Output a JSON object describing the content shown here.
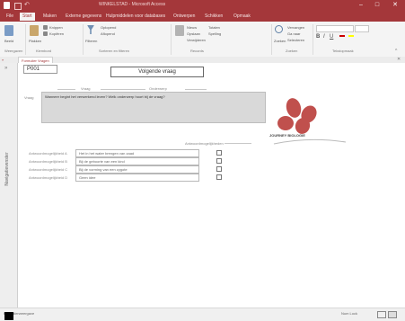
{
  "titlebar": {
    "title": "WINKELSTAD - Microsoft Access",
    "minimize": "–",
    "maximize": "□",
    "close": "✕"
  },
  "tabs": [
    "File",
    "Start",
    "Maken",
    "Externe gegevens",
    "Hulpmiddelen voor databases",
    "Ontwerpen",
    "Schikken",
    "Opmaak"
  ],
  "ribbon": {
    "groups": [
      "Weergaven",
      "Klembord",
      "Sorteren en filteren",
      "Records",
      "Zoeken",
      "Tekstopmaak"
    ],
    "buttons": [
      "Beeld",
      "Plakken",
      "Knippen",
      "Kopiëren",
      "Filteren",
      "Oplopend",
      "Aflopend",
      "Nieuw",
      "Opslaan",
      "Verwijderen",
      "Totalen",
      "Spelling",
      "Zoeken",
      "Vervangen",
      "Ga naar",
      "Selecteren"
    ]
  },
  "objtab": {
    "label": "Formulier Vragen"
  },
  "nav": {
    "label": "Navigatievenster"
  },
  "form": {
    "id_value": "P001",
    "title_button": "Volgende vraag",
    "col_left": "Vraag",
    "col_right": "Onderwerp",
    "q_label": "Vraag",
    "question": "Wanneer begint het verwerkend leven? Welk onderwerp hoort bij de vraag?",
    "answer_header": "Antwoordmogelijkheden",
    "answers": [
      {
        "label": "Antwoordmogelijkheid A",
        "value": "Het in het water brengen van zaad"
      },
      {
        "label": "Antwoordmogelijkheid B",
        "value": "Bij de geboorte van een kind"
      },
      {
        "label": "Antwoordmogelijkheid C",
        "value": "Bij de vorming van een zygote"
      },
      {
        "label": "Antwoordmogelijkheid D",
        "value": "Geen idee"
      }
    ],
    "logo_text": "JOURNEY BIOLOGIE"
  },
  "statusbar": {
    "left": "Formulierweergave",
    "right": "Num Lock"
  },
  "colors": {
    "brand": "#a4373a",
    "logo": "#c0504d"
  }
}
